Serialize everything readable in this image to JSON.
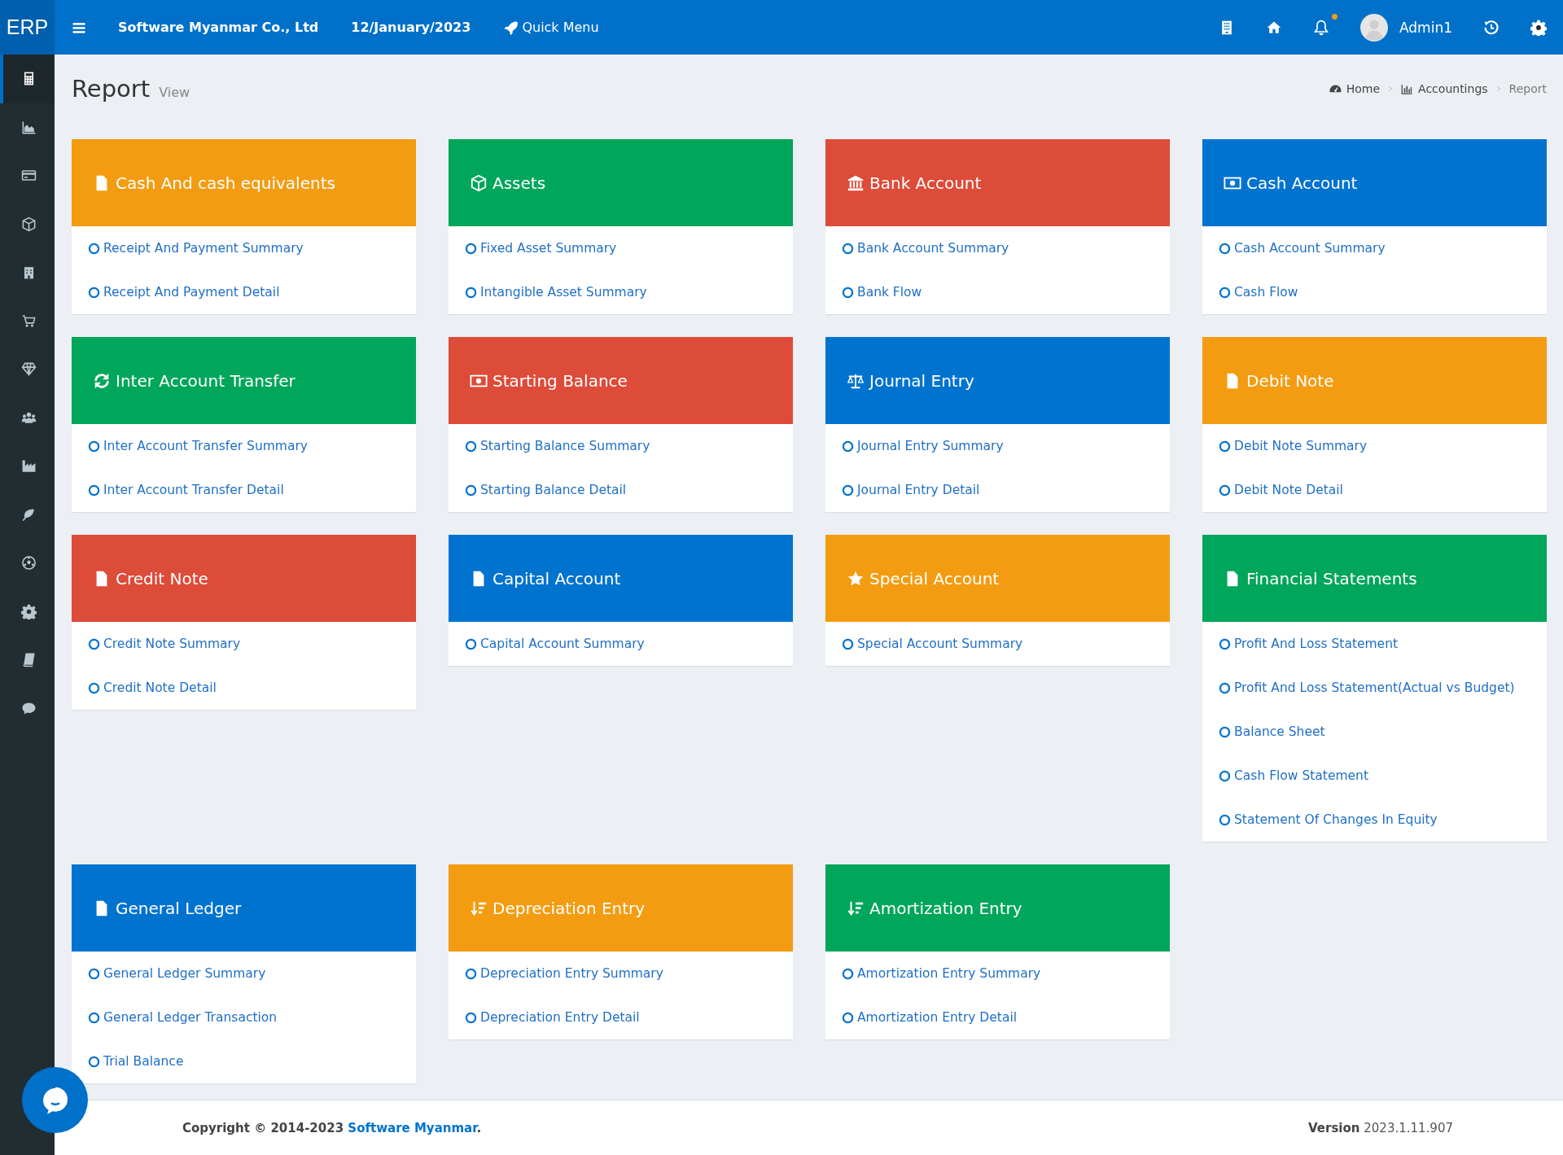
{
  "topbar": {
    "logo": "ERP",
    "company": "Software Myanmar Co., Ltd",
    "date": "12/January/2023",
    "quick_menu": "Quick Menu",
    "notification_dot": true,
    "user": "Admin1"
  },
  "sidebar": {
    "items": [
      {
        "kind": "calculator",
        "selected": true
      },
      {
        "kind": "area-chart",
        "selected": false
      },
      {
        "kind": "card",
        "selected": false
      },
      {
        "kind": "cube",
        "selected": false
      },
      {
        "kind": "hospital",
        "selected": false
      },
      {
        "kind": "cart",
        "selected": false
      },
      {
        "kind": "diamond",
        "selected": false
      },
      {
        "kind": "users",
        "selected": false
      },
      {
        "kind": "factory",
        "selected": false
      },
      {
        "kind": "leaf",
        "selected": false
      },
      {
        "kind": "ball",
        "selected": false
      },
      {
        "kind": "gear",
        "selected": false
      },
      {
        "kind": "book",
        "selected": false
      },
      {
        "kind": "comment",
        "selected": false
      }
    ]
  },
  "page": {
    "title": "Report",
    "subtitle": "View"
  },
  "breadcrumb": [
    {
      "label": "Home",
      "kind": "dashboard"
    },
    {
      "label": "Accountings",
      "kind": "bars"
    },
    {
      "label": "Report",
      "kind": "current"
    }
  ],
  "cards": [
    {
      "title": "Cash And cash equivalents",
      "color": "#f39c12",
      "kind": "file",
      "links": [
        "Receipt And Payment Summary",
        "Receipt And Payment Detail"
      ]
    },
    {
      "title": "Assets",
      "color": "#00a65a",
      "kind": "cube",
      "links": [
        "Fixed Asset Summary",
        "Intangible Asset Summary"
      ]
    },
    {
      "title": "Bank Account",
      "color": "#dd4b39",
      "kind": "bank",
      "links": [
        "Bank Account Summary",
        "Bank Flow"
      ]
    },
    {
      "title": "Cash Account",
      "color": "#0073cf",
      "kind": "money",
      "links": [
        "Cash Account Summary",
        "Cash Flow"
      ]
    },
    {
      "title": "Inter Account Transfer",
      "color": "#00a65a",
      "kind": "refresh",
      "links": [
        "Inter Account Transfer Summary",
        "Inter Account Transfer Detail"
      ]
    },
    {
      "title": "Starting Balance",
      "color": "#dd4b39",
      "kind": "money",
      "links": [
        "Starting Balance Summary",
        "Starting Balance Detail"
      ]
    },
    {
      "title": "Journal Entry",
      "color": "#0073cf",
      "kind": "scale",
      "links": [
        "Journal Entry Summary",
        "Journal Entry Detail"
      ]
    },
    {
      "title": "Debit Note",
      "color": "#f39c12",
      "kind": "file",
      "links": [
        "Debit Note Summary",
        "Debit Note Detail"
      ]
    },
    {
      "title": "Credit Note",
      "color": "#dd4b39",
      "kind": "file",
      "links": [
        "Credit Note Summary",
        "Credit Note Detail"
      ]
    },
    {
      "title": "Capital Account",
      "color": "#0073cf",
      "kind": "file",
      "links": [
        "Capital Account Summary"
      ]
    },
    {
      "title": "Special Account",
      "color": "#f39c12",
      "kind": "star",
      "links": [
        "Special Account Summary"
      ]
    },
    {
      "title": "Financial Statements",
      "color": "#00a65a",
      "kind": "file",
      "links": [
        "Profit And Loss Statement",
        "Profit And Loss Statement(Actual vs Budget)",
        "Balance Sheet",
        "Cash Flow Statement",
        "Statement Of Changes In Equity"
      ]
    },
    {
      "title": "General Ledger",
      "color": "#0073cf",
      "kind": "file",
      "links": [
        "General Ledger Summary",
        "General Ledger Transaction",
        "Trial Balance"
      ]
    },
    {
      "title": "Depreciation Entry",
      "color": "#f39c12",
      "kind": "sort",
      "links": [
        "Depreciation Entry Summary",
        "Depreciation Entry Detail"
      ]
    },
    {
      "title": "Amortization Entry",
      "color": "#00a65a",
      "kind": "sort",
      "links": [
        "Amortization Entry Summary",
        "Amortization Entry Detail"
      ]
    }
  ],
  "footer": {
    "copyright": "Copyright © 2014-2023",
    "link": "Software Myanmar",
    "end": ".",
    "version_label": "Version",
    "version": "2023.1.11.907"
  }
}
